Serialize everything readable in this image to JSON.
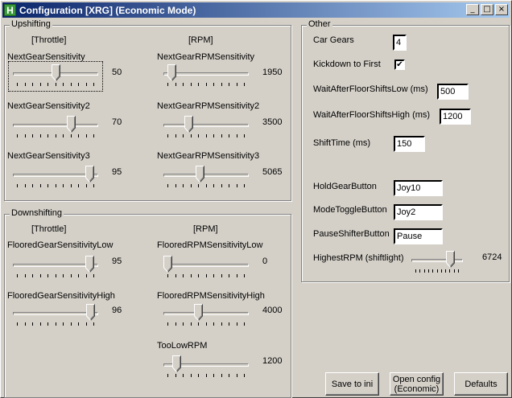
{
  "window": {
    "title": "Configuration [XRG] (Economic Mode)",
    "icon_letter": "H",
    "minimize_glyph": "_",
    "maximize_glyph": "□",
    "close_glyph": "×"
  },
  "upshifting": {
    "title": "Upshifting",
    "throttle_header": "[Throttle]",
    "rpm_header": "[RPM]",
    "throttle_sliders": [
      {
        "label": "NextGearSensitivity",
        "value": "50",
        "level": 0.5
      },
      {
        "label": "NextGearSensitivity2",
        "value": "70",
        "level": 0.7
      },
      {
        "label": "NextGearSensitivity3",
        "value": "95",
        "level": 0.95
      }
    ],
    "rpm_sliders": [
      {
        "label": "NextGearRPMSensitivity",
        "value": "1950",
        "level": 0.05
      },
      {
        "label": "NextGearRPMSensitivity2",
        "value": "3500",
        "level": 0.27
      },
      {
        "label": "NextGearRPMSensitivity3",
        "value": "5065",
        "level": 0.42
      }
    ]
  },
  "downshifting": {
    "title": "Downshifting",
    "throttle_header": "[Throttle]",
    "rpm_header": "[RPM]",
    "throttle_sliders": [
      {
        "label": "FlooredGearSensitivityLow",
        "value": "95",
        "level": 0.95
      },
      {
        "label": "FlooredGearSensitivityHigh",
        "value": "96",
        "level": 0.96
      }
    ],
    "rpm_sliders": [
      {
        "label": "FlooredRPMSensitivityLow",
        "value": "0",
        "level": 0.0
      },
      {
        "label": "FlooredRPMSensitivityHigh",
        "value": "4000",
        "level": 0.4
      },
      {
        "label": "TooLowRPM",
        "value": "1200",
        "level": 0.12
      }
    ]
  },
  "other": {
    "title": "Other",
    "car_gears_label": "Car Gears",
    "car_gears_value": "4",
    "kickdown_label": "Kickdown to First",
    "kickdown_checked": "✔",
    "wait_low_label": "WaitAfterFloorShiftsLow (ms)",
    "wait_low_value": "500",
    "wait_high_label": "WaitAfterFloorShiftsHigh (ms)",
    "wait_high_value": "1200",
    "shift_time_label": "ShiftTime (ms)",
    "shift_time_value": "150",
    "hold_gear_label": "HoldGearButton",
    "hold_gear_value": "Joy10",
    "mode_toggle_label": "ModeToggleButton",
    "mode_toggle_value": "Joy2",
    "pause_shifter_label": "PauseShifterButton",
    "pause_shifter_value": "Pause",
    "highest_rpm_label": "HighestRPM (shiftlight)",
    "highest_rpm_value": "6724",
    "highest_rpm_level": 0.82
  },
  "buttons": {
    "save": "Save to ini",
    "open": "Open config\n(Economic)",
    "defaults": "Defaults"
  }
}
